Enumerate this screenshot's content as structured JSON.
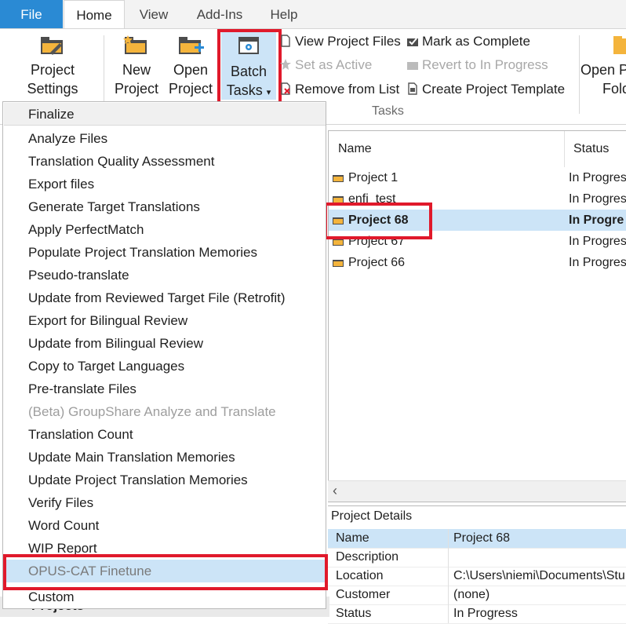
{
  "tabs": {
    "file": "File",
    "home": "Home",
    "view": "View",
    "addins": "Add-Ins",
    "help": "Help"
  },
  "ribbon": {
    "project_settings": [
      "Project",
      "Settings"
    ],
    "new_project": [
      "New",
      "Project"
    ],
    "open_project": [
      "Open",
      "Project"
    ],
    "batch_tasks": [
      "Batch",
      "Tasks"
    ],
    "batch_tasks_arrow": "▾",
    "view_project_files": "View Project Files",
    "mark_as_complete": "Mark as Complete",
    "set_as_active": "Set as Active",
    "revert_to_in_progress": "Revert to In Progress",
    "remove_from_list": "Remove from List",
    "create_project_template": "Create Project Template",
    "open_project_folder": [
      "Open P",
      "Fold"
    ],
    "group_tasks": "Tasks"
  },
  "menu": {
    "items": [
      "Finalize",
      "Analyze Files",
      "Translation Quality Assessment",
      "Export files",
      "Generate Target Translations",
      "Apply PerfectMatch",
      "Populate Project Translation Memories",
      "Pseudo-translate",
      "Update from Reviewed Target File (Retrofit)",
      "Export for Bilingual Review",
      "Update from Bilingual Review",
      "Copy to Target Languages",
      "Pre-translate Files",
      "(Beta) GroupShare Analyze and Translate",
      "Translation Count",
      "Update Main Translation Memories",
      "Update Project Translation Memories",
      "Verify Files",
      "Word Count",
      "WIP Report",
      "OPUS-CAT Finetune",
      "Custom"
    ]
  },
  "projects": {
    "col_name": "Name",
    "col_status": "Status",
    "rows": [
      {
        "name": "Project 1",
        "status": "In Progres"
      },
      {
        "name": "enfi_test",
        "status": "In Progres"
      },
      {
        "name": "Project 68",
        "status": "In Progre"
      },
      {
        "name": "Project 67",
        "status": "In Progres"
      },
      {
        "name": "Project 66",
        "status": "In Progres"
      }
    ],
    "scroll_left": "‹"
  },
  "details": {
    "title": "Project Details",
    "rows": [
      {
        "k": "Name",
        "v": "Project 68"
      },
      {
        "k": "Description",
        "v": ""
      },
      {
        "k": "Location",
        "v": "C:\\Users\\niemi\\Documents\\Stu"
      },
      {
        "k": "Customer",
        "v": "(none)"
      },
      {
        "k": "Status",
        "v": "In Progress"
      }
    ]
  },
  "bottom": {
    "projects_label": "Projects"
  },
  "colors": {
    "accent": "#2a8ad4",
    "highlight": "#cce4f7",
    "annotation": "#e0192b",
    "folder": "#f4b43c"
  }
}
